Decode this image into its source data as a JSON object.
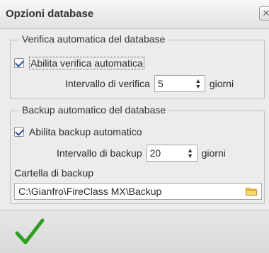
{
  "window": {
    "title": "Opzioni database",
    "close_icon": "close-icon"
  },
  "verifica": {
    "legend": "Verifica automatica del database",
    "checkbox_label": "Abilita verifica automatica",
    "checked": true,
    "interval_label": "Intervallo di verifica",
    "interval_value": "5",
    "unit": "giorni"
  },
  "backup": {
    "legend": "Backup automatico del database",
    "checkbox_label": "Abilita backup automatico",
    "checked": true,
    "interval_label": "Intervallo di backup",
    "interval_value": "20",
    "unit": "giorni",
    "folder_label": "Cartella di backup",
    "folder_value": "C:\\Gianfro\\FireClass MX\\Backup",
    "folder_icon": "folder-icon"
  },
  "footer": {
    "ok_icon": "checkmark-icon",
    "ok_color": "#2e9e1f"
  }
}
